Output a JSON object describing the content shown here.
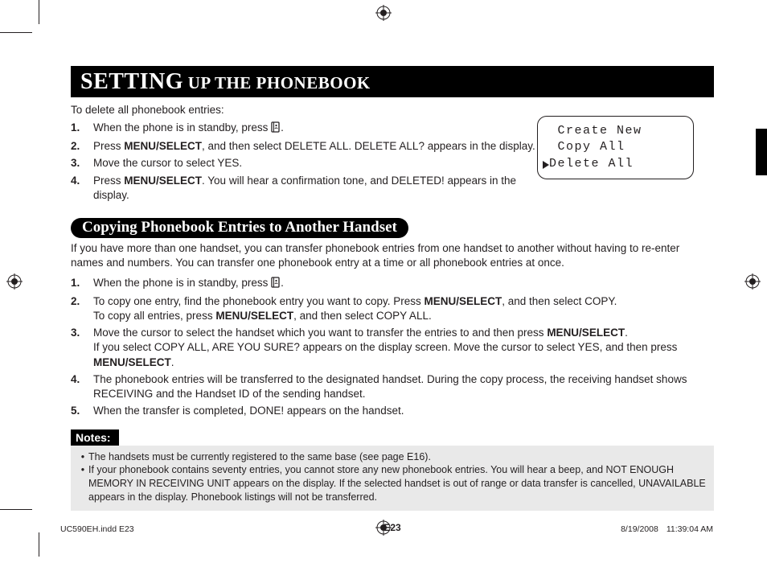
{
  "title": {
    "big": "SETTING",
    "small": " UP THE PHONEBOOK"
  },
  "delete": {
    "intro": "To delete all phonebook entries:",
    "steps": [
      {
        "n": "1.",
        "pre": "When the phone is in standby, press ",
        "post": "."
      },
      {
        "n": "2.",
        "pre": "Press ",
        "bold": "MENU/SELECT",
        "post": ", and then select DELETE ALL. DELETE ALL? appears in the display."
      },
      {
        "n": "3.",
        "pre": "Move the cursor to select YES.",
        "bold": "",
        "post": ""
      },
      {
        "n": "4.",
        "pre": "Press ",
        "bold": "MENU/SELECT",
        "post": ". You will hear a confirmation tone, and DELETED! appears in the display."
      }
    ]
  },
  "lcd": {
    "line1": " Create New",
    "line2": " Copy All",
    "line3": "Delete All"
  },
  "subheading": "Copying Phonebook Entries to Another Handset",
  "copy": {
    "intro": "If you have more than one handset, you can transfer phonebook entries from one handset to another without having to re-enter names and numbers. You can transfer one phonebook entry at a time or all phonebook entries at once.",
    "steps": {
      "s1": {
        "n": "1.",
        "pre": "When the phone is in standby, press ",
        "post": "."
      },
      "s2": {
        "n": "2.",
        "a_pre": "To copy one entry, find the phonebook entry you want to copy. Press ",
        "a_bold": "MENU/SELECT",
        "a_post": ", and then select COPY.",
        "b_pre": "To copy all entries, press ",
        "b_bold": "MENU/SELECT",
        "b_post": ", and then select COPY ALL."
      },
      "s3": {
        "n": "3.",
        "a_pre": "Move the cursor to select the handset which you want to transfer the entries to and then press ",
        "a_bold": "MENU/SELECT",
        "a_post": ".",
        "b_pre": "If you select COPY ALL, ARE YOU SURE? appears on the display screen. Move the cursor to select YES, and then press ",
        "b_bold": "MENU/SELECT",
        "b_post": "."
      },
      "s4": {
        "n": "4.",
        "text": "The phonebook entries will be transferred to the designated handset. During the copy process, the receiving handset shows RECEIVING and the Handset ID of the sending handset."
      },
      "s5": {
        "n": "5.",
        "text": "When the transfer is completed, DONE! appears on the handset."
      }
    }
  },
  "notes": {
    "label": "Notes:",
    "items": [
      "The handsets must be currently registered to the same base (see page E16).",
      "If your phonebook contains seventy entries, you cannot store any new phonebook entries. You will hear a beep, and NOT ENOUGH MEMORY IN RECEIVING UNIT appears on the display. If the selected handset is out of range or data transfer is cancelled, UNAVAILABLE appears in the display. Phonebook listings will not be transferred."
    ]
  },
  "page_num": "E23",
  "footer": {
    "file": "UC590EH.indd   E23",
    "date": "8/19/2008",
    "time": "11:39:04 AM"
  }
}
